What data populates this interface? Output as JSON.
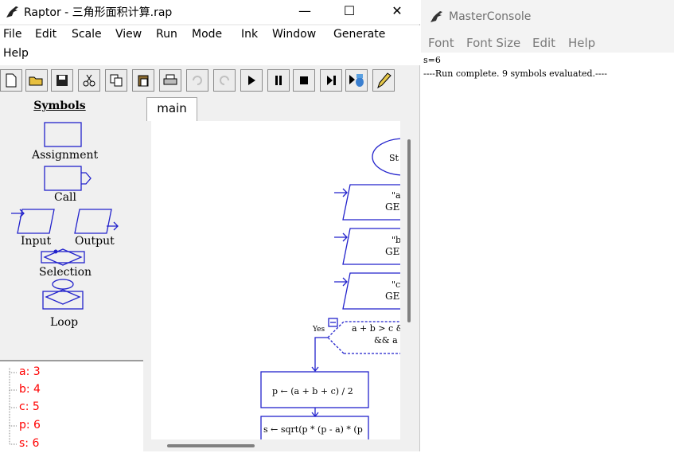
{
  "raptor": {
    "title": "Raptor - 三角形面积计算.rap",
    "window_buttons": {
      "minimize": "—",
      "maximize": "☐",
      "close": "✕"
    },
    "menu": [
      "File",
      "Edit",
      "Scale",
      "View",
      "Run",
      "Mode",
      "Ink",
      "Window",
      "Generate",
      "Help"
    ],
    "symbols": {
      "title": "Symbols",
      "assignment": "Assignment",
      "call": "Call",
      "input": "Input",
      "output": "Output",
      "selection": "Selection",
      "loop": "Loop"
    },
    "tab": "main",
    "flow": {
      "start": "St",
      "out1_a": "\"a",
      "out1_b": "GE",
      "out2_a": "\"b",
      "out2_b": "GE",
      "out3_a": "\"c",
      "out3_b": "GE",
      "yes": "Yes",
      "cond1": "a + b > c &",
      "cond2": "&& a",
      "assign_p": "p ← (a + b + c) / 2",
      "assign_s": "s ← sqrt(p * (p - a) * (p"
    },
    "variables": [
      {
        "label": "a: 3"
      },
      {
        "label": "b: 4"
      },
      {
        "label": "c: 5"
      },
      {
        "label": "p: 6"
      },
      {
        "label": "s: 6"
      }
    ]
  },
  "console": {
    "title": "MasterConsole",
    "menu": [
      "Font",
      "Font Size",
      "Edit",
      "Help"
    ],
    "lines": [
      "s=6",
      "----Run complete.  9 symbols evaluated.----"
    ]
  },
  "colors": {
    "flowchart": "#2222cc",
    "variables": "#ff0000"
  }
}
